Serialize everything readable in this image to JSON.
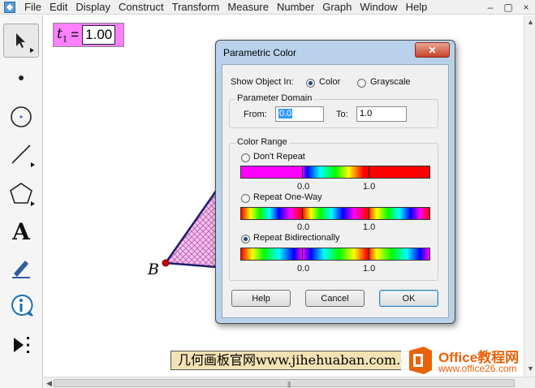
{
  "menubar": {
    "items": [
      "File",
      "Edit",
      "Display",
      "Construct",
      "Transform",
      "Measure",
      "Number",
      "Graph",
      "Window",
      "Help"
    ],
    "window_controls": [
      "–",
      "▢",
      "×"
    ]
  },
  "toolbox": {
    "tools": [
      {
        "name": "arrow-tool-icon",
        "selected": true
      },
      {
        "name": "point-tool-icon"
      },
      {
        "name": "compass-tool-icon"
      },
      {
        "name": "straightedge-tool-icon"
      },
      {
        "name": "polygon-tool-icon"
      },
      {
        "name": "text-tool-icon",
        "glyph": "A"
      },
      {
        "name": "marker-tool-icon"
      },
      {
        "name": "information-tool-icon"
      },
      {
        "name": "custom-tool-icon"
      }
    ]
  },
  "canvas": {
    "parameter": {
      "name": "t",
      "subscript": "1",
      "equals": "=",
      "value": "1.00"
    },
    "point_label": "B",
    "caption": "几何画板官网www.jihehuaban.com.cn"
  },
  "watermark": {
    "title": "Office教程网",
    "url": "www.office26.com"
  },
  "dialog": {
    "title": "Parametric Color",
    "close_label": "✕",
    "show_object_in": {
      "label": "Show Object In:",
      "options": [
        "Color",
        "Grayscale"
      ],
      "selected": "Color"
    },
    "parameter_domain": {
      "title": "Parameter Domain",
      "from_label": "From:",
      "from_value": "0.0",
      "to_label": "To:",
      "to_value": "1.0"
    },
    "color_range": {
      "title": "Color Range",
      "options": [
        "Don't Repeat",
        "Repeat One-Way",
        "Repeat Bidirectionally"
      ],
      "selected": "Repeat Bidirectionally",
      "tick_labels": [
        "0.0",
        "1.0"
      ]
    },
    "buttons": {
      "help": "Help",
      "cancel": "Cancel",
      "ok": "OK"
    }
  },
  "colors": {
    "parameter_bg": "#ff80ff",
    "polygon_fill": "#f3c1ee",
    "polygon_edge": "#1d1d6a",
    "point": "#cc0000",
    "caption_bg": "#f3e2b3",
    "dialog_frame": "#b9d1ea",
    "watermark_orange": "#e8620a"
  }
}
